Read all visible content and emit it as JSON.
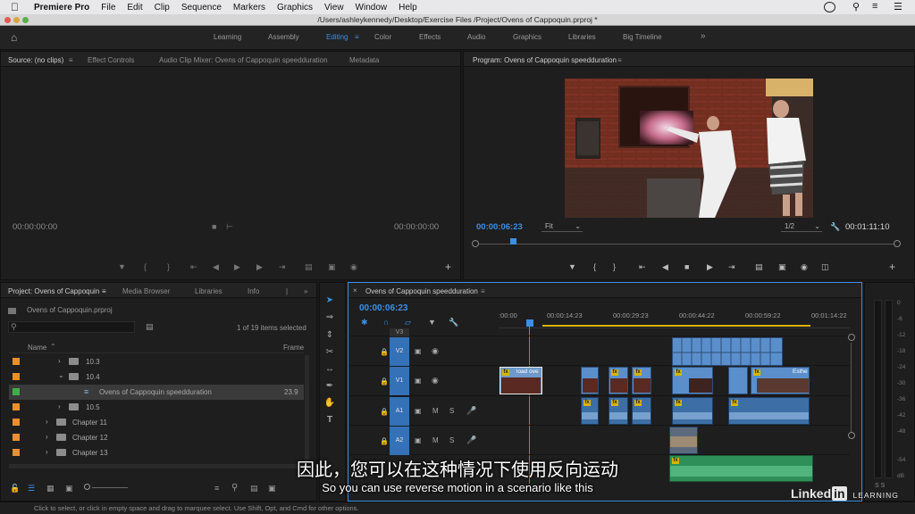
{
  "menubar": {
    "app_name": "Premiere Pro",
    "items": [
      "File",
      "Edit",
      "Clip",
      "Sequence",
      "Markers",
      "Graphics",
      "View",
      "Window",
      "Help"
    ]
  },
  "titlebar": {
    "path": "/Users/ashleykennedy/Desktop/Exercise Files /Project/Ovens of Cappoquin.prproj *"
  },
  "workspace": {
    "items": [
      "Learning",
      "Assembly",
      "Editing",
      "Color",
      "Effects",
      "Audio",
      "Graphics",
      "Libraries",
      "Big Timeline"
    ],
    "active": "Editing",
    "more": "»"
  },
  "source_panel": {
    "tabs": [
      "Source: (no clips)",
      "Effect Controls",
      "Audio Clip Mixer: Ovens of Cappoquin speedduration",
      "Metadata"
    ],
    "timecode_left": "00:00:00:00",
    "timecode_right": "00:00:00:00"
  },
  "program_panel": {
    "title": "Program: Ovens of Cappoquin speedduration",
    "timecode": "00:00:06:23",
    "fit": "Fit",
    "resolution": "1/2",
    "duration": "00:01:11:10"
  },
  "project_panel": {
    "tabs": [
      "Project: Ovens of Cappoquin",
      "Media Browser",
      "Libraries",
      "Info"
    ],
    "project_file": "Ovens of Cappoquin.prproj",
    "items_selected": "1 of 19 items selected",
    "col_name": "Name",
    "col_frame": "Frame",
    "rows": [
      {
        "label": "10.3",
        "color": "#e8912c",
        "type": "folder",
        "indent": 1
      },
      {
        "label": "10.4",
        "color": "#e8912c",
        "type": "folder",
        "indent": 1
      },
      {
        "label": "Ovens of Cappoquin speedduration",
        "color": "#3fae49",
        "type": "sequence",
        "indent": 2,
        "frame": "23.9"
      },
      {
        "label": "10.5",
        "color": "#e8912c",
        "type": "folder",
        "indent": 1
      },
      {
        "label": "Chapter 11",
        "color": "#e8912c",
        "type": "folder",
        "indent": 0
      },
      {
        "label": "Chapter 12",
        "color": "#e8912c",
        "type": "folder",
        "indent": 0
      },
      {
        "label": "Chapter 13",
        "color": "#e8912c",
        "type": "folder",
        "indent": 0
      }
    ]
  },
  "timeline": {
    "title": "Ovens of Cappoquin speedduration",
    "timecode": "00:00:06:23",
    "ruler": [
      ":00:00",
      "00:00:14:23",
      "00:00:29:23",
      "00:00:44:22",
      "00:00:59:22",
      "00:01:14:22"
    ],
    "tracks": [
      "V3",
      "V2",
      "V1",
      "A1",
      "A2"
    ],
    "track_letters": {
      "mute": "M",
      "solo": "S"
    },
    "clip_label_1": "load ove",
    "clip_label_2": "Esthe",
    "fx": "fx"
  },
  "meters": {
    "labels": [
      "0",
      "-6",
      "-12",
      "-18",
      "-24",
      "-30",
      "-36",
      "-42",
      "-48",
      "-54",
      "dB"
    ],
    "solo": "S S"
  },
  "status_bar": "Click to select, or click in empty space and drag to marquee select. Use Shift, Opt, and Cmd for other options.",
  "subtitles": {
    "chinese": "因此，您可以在这种情况下使用反向运动",
    "english": "So you can use reverse motion in a scenario like this"
  },
  "watermark": {
    "brand": "Linked",
    "in": "in",
    "suffix": "LEARNING"
  }
}
